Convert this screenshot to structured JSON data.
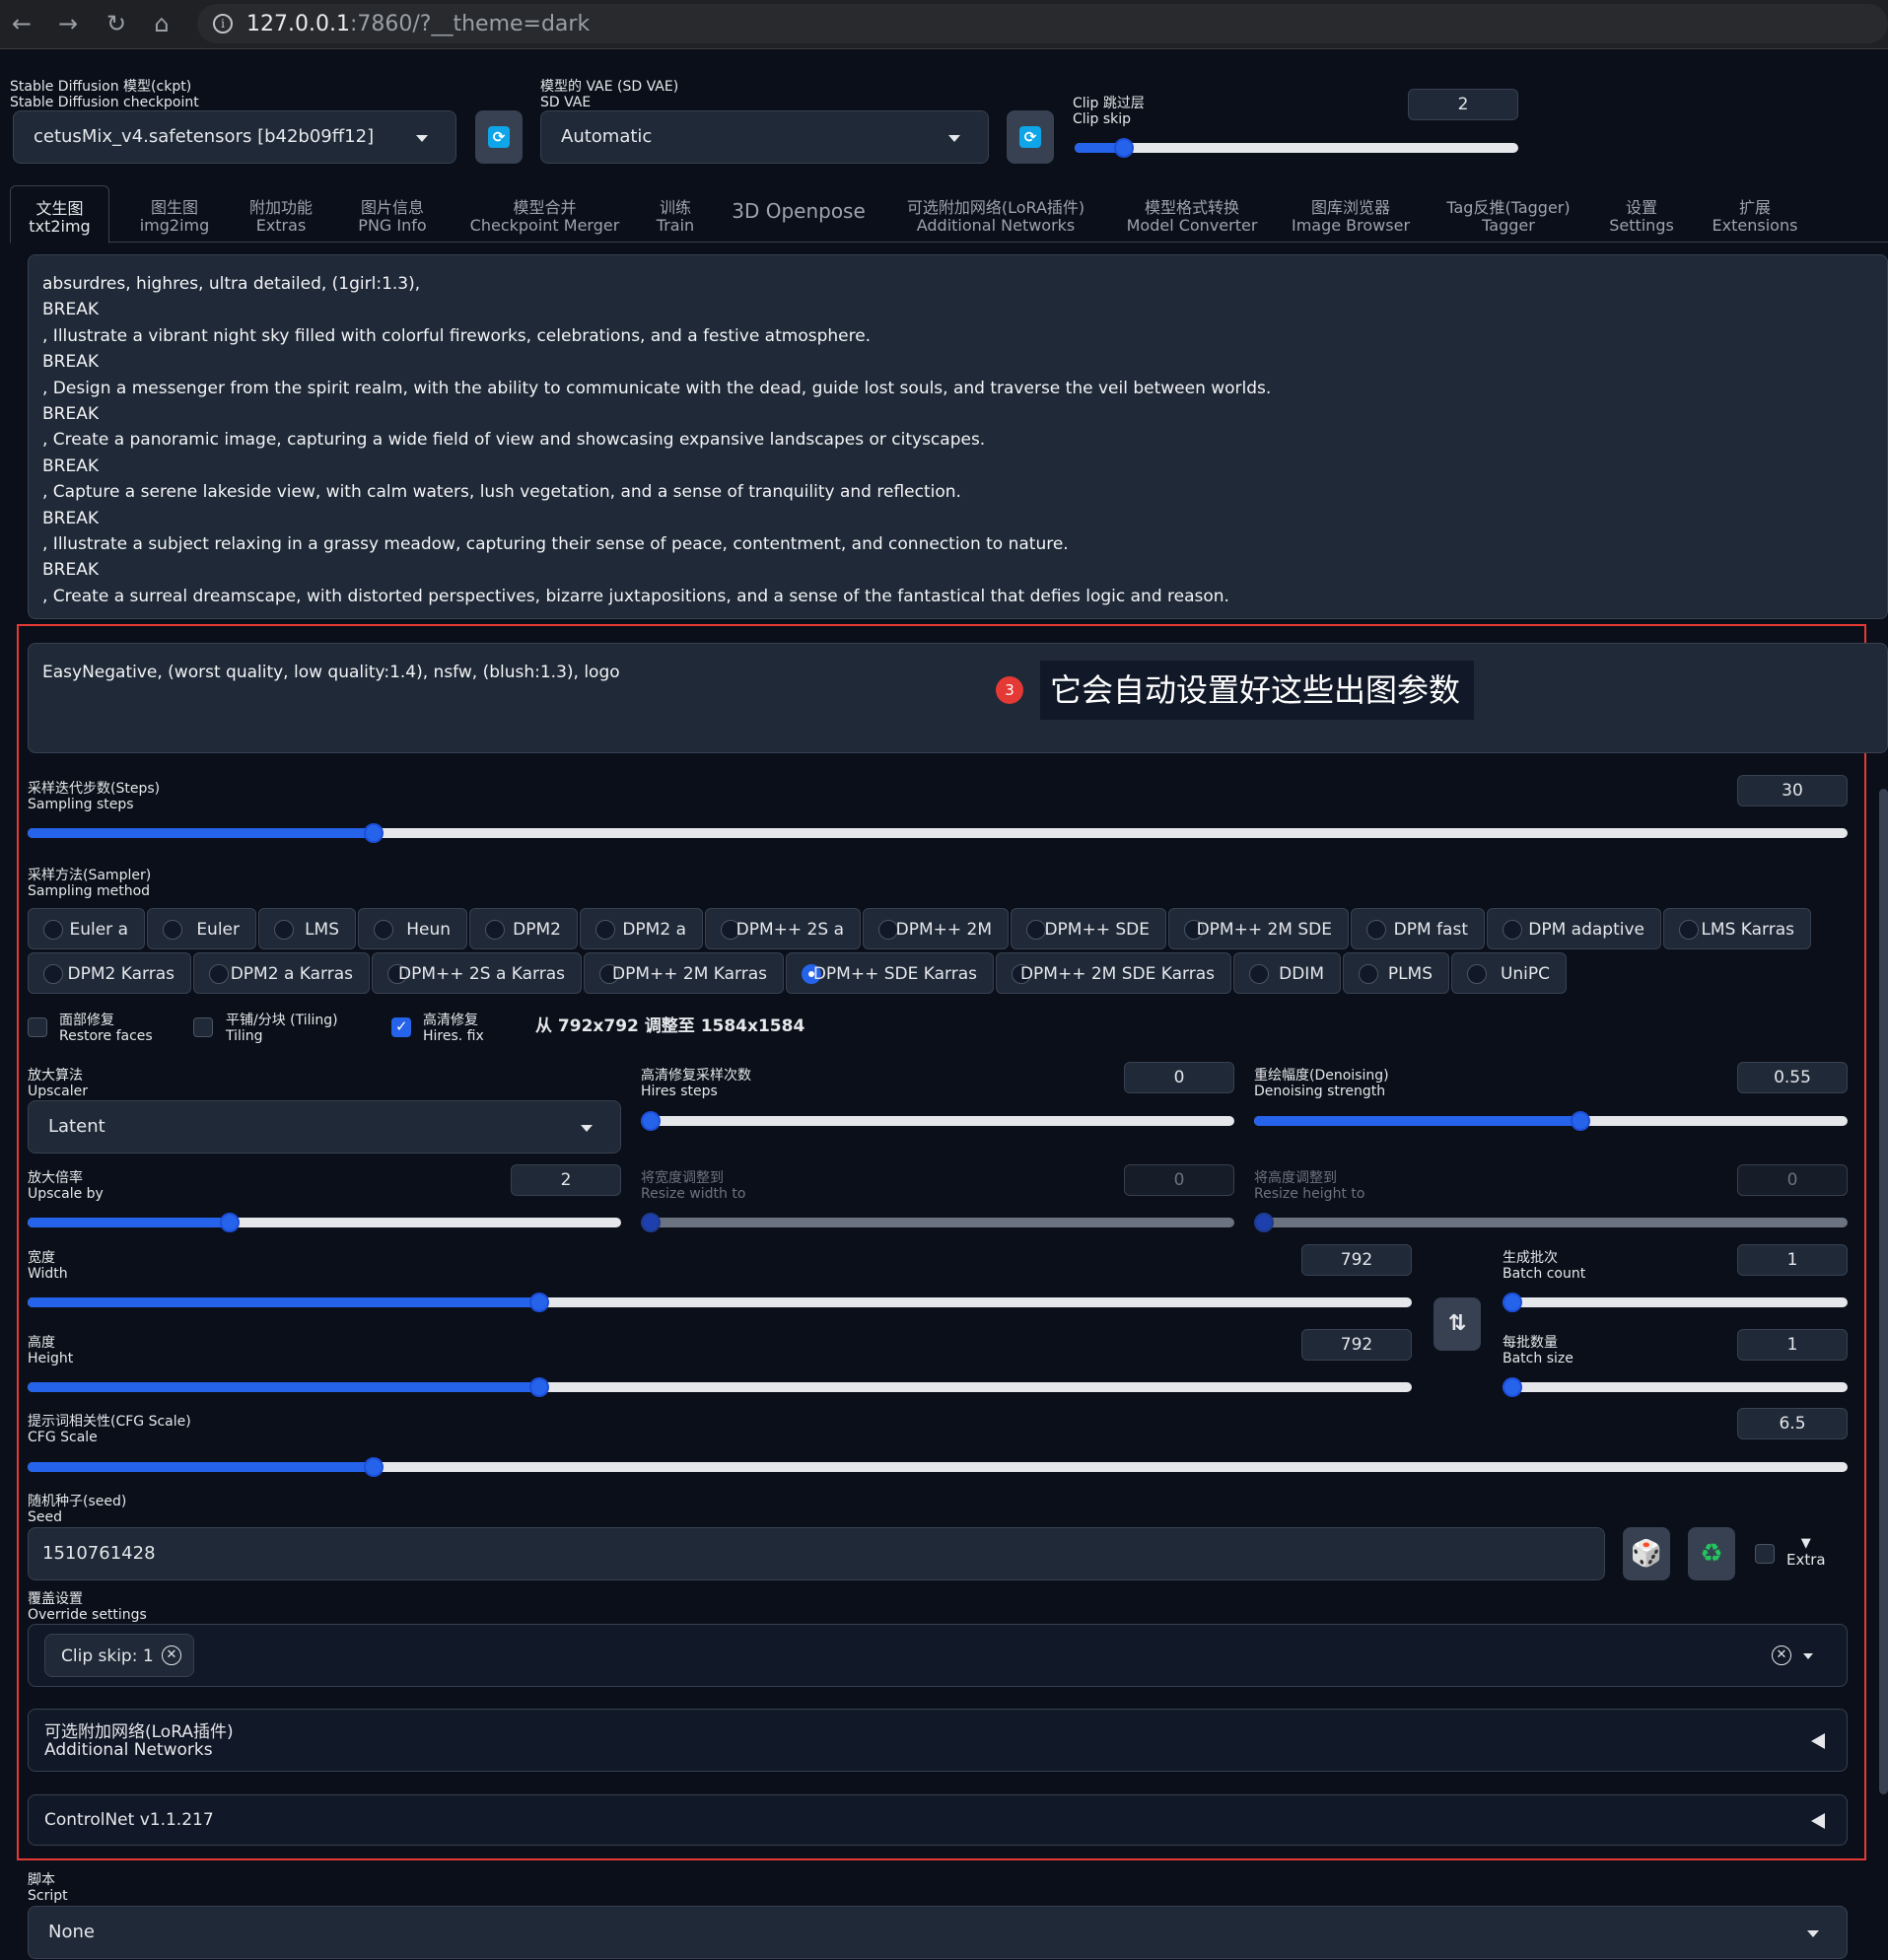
{
  "browser": {
    "url_main": "127.0.0.1",
    "url_rest": ":7860/?__theme=dark"
  },
  "top": {
    "ckpt_label_cn": "Stable Diffusion 模型(ckpt)",
    "ckpt_label_en": "Stable Diffusion checkpoint",
    "ckpt_value": "cetusMix_v4.safetensors [b42b09ff12]",
    "vae_label_cn": "模型的 VAE (SD VAE)",
    "vae_label_en": "SD VAE",
    "vae_value": "Automatic",
    "clip_label_cn": "Clip 跳过层",
    "clip_label_en": "Clip skip",
    "clip_value": "2",
    "clip_fraction": 0.11
  },
  "tabs": [
    {
      "cn": "文生图",
      "en": "txt2img",
      "active": true
    },
    {
      "cn": "图生图",
      "en": "img2img"
    },
    {
      "cn": "附加功能",
      "en": "Extras"
    },
    {
      "cn": "图片信息",
      "en": "PNG Info"
    },
    {
      "cn": "模型合并",
      "en": "Checkpoint Merger"
    },
    {
      "cn": "训练",
      "en": "Train"
    },
    {
      "single": "3D Openpose"
    },
    {
      "cn": "可选附加网络(LoRA插件)",
      "en": "Additional Networks"
    },
    {
      "cn": "模型格式转换",
      "en": "Model Converter"
    },
    {
      "cn": "图库浏览器",
      "en": "Image Browser"
    },
    {
      "cn": "Tag反推(Tagger)",
      "en": "Tagger"
    },
    {
      "cn": "设置",
      "en": "Settings"
    },
    {
      "cn": "扩展",
      "en": "Extensions"
    }
  ],
  "prompt": {
    "lines": [
      "absurdres, highres, ultra detailed, (1girl:1.3),",
      "BREAK",
      ", Illustrate a vibrant night sky filled with colorful fireworks, celebrations, and a festive atmosphere.",
      "BREAK",
      ", Design a messenger from the spirit realm, with the ability to communicate with the dead, guide lost souls, and traverse the veil between worlds.",
      "BREAK",
      ", Create a panoramic image, capturing a wide field of view and showcasing expansive landscapes or cityscapes.",
      "BREAK",
      ", Capture a serene lakeside view, with calm waters, lush vegetation, and a sense of tranquility and reflection.",
      "BREAK",
      ", Illustrate a subject relaxing in a grassy meadow, capturing their sense of peace, contentment, and connection to nature.",
      "BREAK",
      ", Create a surreal dreamscape, with distorted perspectives, bizarre juxtapositions, and a sense of the fantastical that defies logic and reason."
    ]
  },
  "negative_prompt": "EasyNegative, (worst quality, low quality:1.4),  nsfw,  (blush:1.3), logo",
  "annotation": {
    "badge": "3",
    "text": "它会自动设置好这些出图参数"
  },
  "steps": {
    "cn": "采样迭代步数(Steps)",
    "en": "Sampling steps",
    "value": "30",
    "fraction": 0.19
  },
  "sampler": {
    "cn": "采样方法(Sampler)",
    "en": "Sampling method",
    "row1": [
      "Euler a",
      "Euler",
      "LMS",
      "Heun",
      "DPM2",
      "DPM2 a",
      "DPM++ 2S a",
      "DPM++ 2M",
      "DPM++ SDE",
      "DPM++ 2M SDE",
      "DPM fast",
      "DPM adaptive",
      "LMS Karras"
    ],
    "row2": [
      "DPM2 Karras",
      "DPM2 a Karras",
      "DPM++ 2S a Karras",
      "DPM++ 2M Karras",
      "DPM++ SDE Karras",
      "DPM++ 2M SDE Karras",
      "DDIM",
      "PLMS",
      "UniPC"
    ],
    "selected": "DPM++ SDE Karras"
  },
  "options": {
    "restore_cn": "面部修复",
    "restore_en": "Restore faces",
    "tiling_cn": "平铺/分块 (Tiling)",
    "tiling_en": "Tiling",
    "hires_cn": "高清修复",
    "hires_en": "Hires. fix",
    "hires_info": "从 792x792 调整至 1584x1584"
  },
  "upscaler": {
    "cn": "放大算法",
    "en": "Upscaler",
    "value": "Latent"
  },
  "hires_steps": {
    "cn": "高清修复采样次数",
    "en": "Hires steps",
    "value": "0",
    "fraction": 0.0
  },
  "denoising": {
    "cn": "重绘幅度(Denoising)",
    "en": "Denoising strength",
    "value": "0.55",
    "fraction": 0.55
  },
  "upscale_by": {
    "cn": "放大倍率",
    "en": "Upscale by",
    "value": "2",
    "fraction": 0.34
  },
  "resize_w": {
    "cn": "将宽度调整到",
    "en": "Resize width to",
    "value": "0",
    "fraction": 0.0
  },
  "resize_h": {
    "cn": "将高度调整到",
    "en": "Resize height to",
    "value": "0",
    "fraction": 0.0
  },
  "width": {
    "cn": "宽度",
    "en": "Width",
    "value": "792",
    "fraction": 0.37
  },
  "height": {
    "cn": "高度",
    "en": "Height",
    "value": "792",
    "fraction": 0.37
  },
  "batch_count": {
    "cn": "生成批次",
    "en": "Batch count",
    "value": "1",
    "fraction": 0.0
  },
  "batch_size": {
    "cn": "每批数量",
    "en": "Batch size",
    "value": "1",
    "fraction": 0.0
  },
  "cfg": {
    "cn": "提示词相关性(CFG Scale)",
    "en": "CFG Scale",
    "value": "6.5",
    "fraction": 0.19
  },
  "seed": {
    "cn": "随机种子(seed)",
    "en": "Seed",
    "value": "1510761428",
    "extra": "Extra"
  },
  "override": {
    "cn": "覆盖设置",
    "en": "Override settings",
    "chip": "Clip skip: 1"
  },
  "addnet": {
    "cn": "可选附加网络(LoRA插件)",
    "en": "Additional Networks"
  },
  "controlnet": "ControlNet v1.1.217",
  "script": {
    "cn": "脚本",
    "en": "Script",
    "value": "None"
  },
  "colors": {
    "accent": "#2563eb",
    "annotation": "#e53935",
    "background": "#0b0f19"
  }
}
